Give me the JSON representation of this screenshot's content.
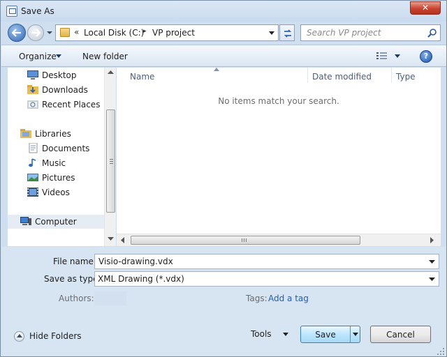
{
  "window": {
    "title": "Save As",
    "close_label": "✕"
  },
  "address": {
    "chevron": "«",
    "segments": [
      "Local Disk (C:)",
      "VP project"
    ],
    "separator": "▸"
  },
  "search": {
    "placeholder": "Search VP project"
  },
  "toolbar": {
    "organize_label": "Organize",
    "new_folder_label": "New folder",
    "help_label": "?"
  },
  "nav": {
    "favorites": [
      {
        "label": "Desktop",
        "icon": "desktop-icon"
      },
      {
        "label": "Downloads",
        "icon": "downloads-folder-icon"
      },
      {
        "label": "Recent Places",
        "icon": "recent-places-icon"
      }
    ],
    "libraries_label": "Libraries",
    "libraries": [
      {
        "label": "Documents",
        "icon": "documents-icon"
      },
      {
        "label": "Music",
        "icon": "music-icon"
      },
      {
        "label": "Pictures",
        "icon": "pictures-icon"
      },
      {
        "label": "Videos",
        "icon": "videos-icon"
      }
    ],
    "computer_label": "Computer"
  },
  "file_list": {
    "columns": [
      "Name",
      "Date modified",
      "Type"
    ],
    "empty_message": "No items match your search."
  },
  "form": {
    "file_name_label": "File name:",
    "file_name_value": "Visio-drawing.vdx",
    "save_type_label": "Save as type:",
    "save_type_value": "XML Drawing (*.vdx)",
    "authors_label": "Authors:",
    "tags_label": "Tags:",
    "tags_link": "Add a tag"
  },
  "footer": {
    "hide_folders_label": "Hide Folders",
    "tools_label": "Tools",
    "save_label": "Save",
    "cancel_label": "Cancel"
  },
  "colors": {
    "accent": "#1c5fb8",
    "close_red": "#c8432e",
    "chrome": "#d7e4f2"
  }
}
